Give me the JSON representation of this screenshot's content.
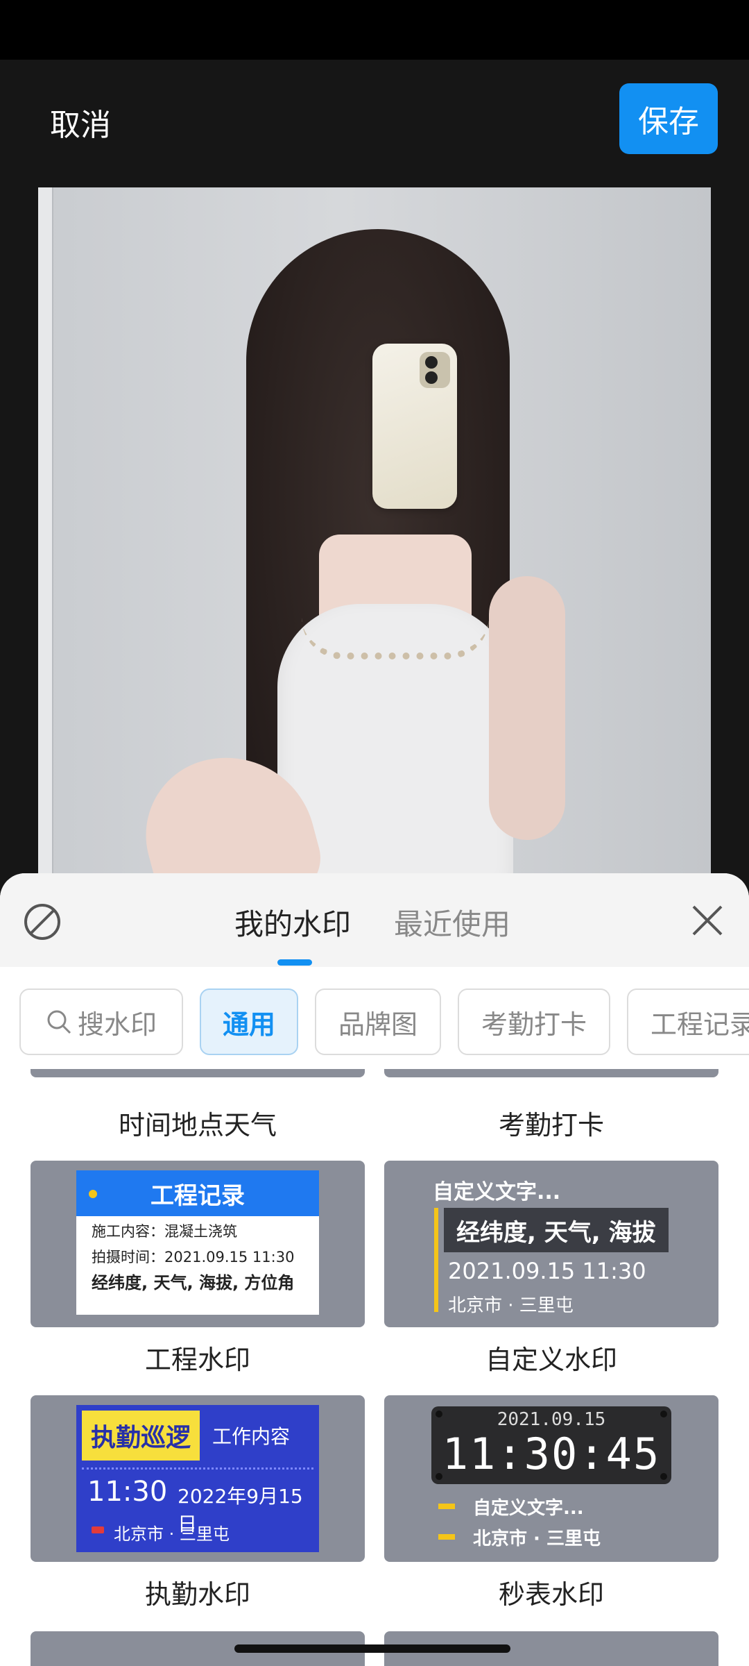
{
  "top_bar": {
    "cancel": "取消",
    "save": "保存"
  },
  "sheet": {
    "tabs": [
      "我的水印",
      "最近使用"
    ],
    "chips": {
      "search": "搜水印",
      "general": "通用",
      "brand": "品牌图",
      "attendance": "考勤打卡",
      "project": "工程记录"
    },
    "labels": {
      "row0_left": "时间地点天气",
      "row0_right": "考勤打卡",
      "project": "工程水印",
      "custom": "自定义水印",
      "duty": "执勤水印",
      "stopwatch": "秒表水印"
    },
    "project_card": {
      "title": "工程记录",
      "line1": "施工内容：混凝土浇筑",
      "line2": "拍摄时间：2021.09.15 11:30",
      "line3": "经纬度, 天气, 海拔, 方位角"
    },
    "custom_card": {
      "title": "自定义文字...",
      "highlight": "经纬度, 天气, 海拔",
      "time": "2021.09.15  11:30",
      "location": "北京市 · 三里屯"
    },
    "duty_card": {
      "tag": "执勤巡逻",
      "work": "工作内容",
      "time": "11:30",
      "date": "2022年9月15日",
      "location": "北京市 · 三里屯"
    },
    "stopwatch_card": {
      "date": "2021.09.15",
      "time": "11:30:45",
      "line1": "自定义文字...",
      "line2": "北京市 · 三里屯"
    }
  },
  "colors": {
    "accent": "#1290f2",
    "card_bg": "#8a8e99",
    "project_blue": "#1f79f0",
    "duty_blue": "#2f3fc9",
    "yellow": "#f5c518"
  }
}
